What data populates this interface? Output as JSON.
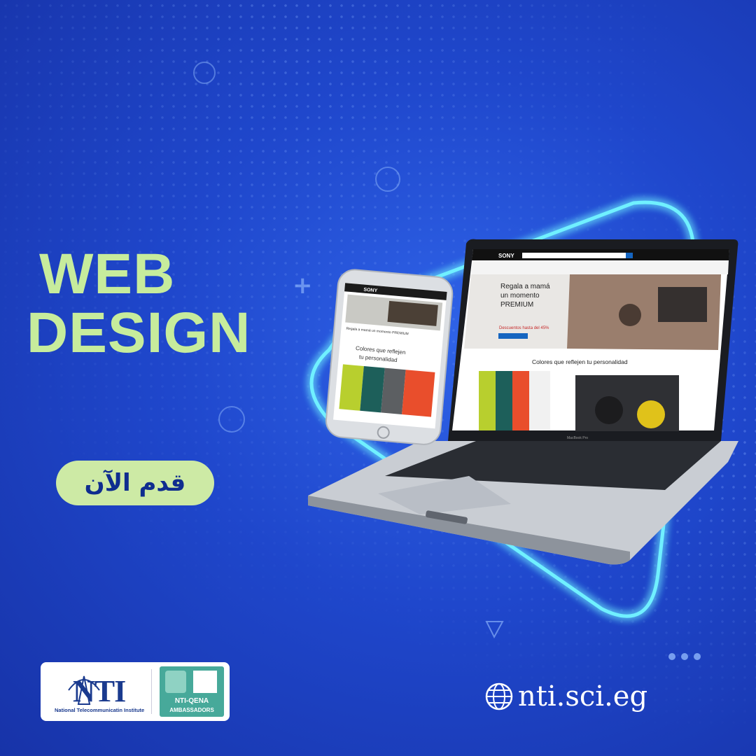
{
  "headline": {
    "line1": "WEB",
    "line2": "DESIGN"
  },
  "cta": {
    "label": "قدم الآن"
  },
  "logos": {
    "nti_name": "NTI",
    "nti_subtitle": "National Telecommunicatin Institute",
    "ambassadors_line1": "NTI-QENA",
    "ambassadors_line2": "AMBASSADORS"
  },
  "website": "nti.sci.eg",
  "laptop": {
    "brand": "SONY",
    "model": "MacBook Pro",
    "hero_line1": "Regala a mamá",
    "hero_line2": "un momento",
    "hero_line3": "PREMIUM",
    "discount": "Descuentos hasta del 45%",
    "section_title": "Colores que reflejen tu personalidad"
  },
  "phone": {
    "brand": "SONY",
    "hero": "Regala a mamá un momento PREMIUM",
    "section_line1": "Colores que reflejen",
    "section_line2": "tu personalidad"
  },
  "colors": {
    "background": "#1f47cc",
    "headline": "#c7ec9c",
    "cta_bg": "#cdeaa5",
    "glow": "#6ff0ff"
  }
}
